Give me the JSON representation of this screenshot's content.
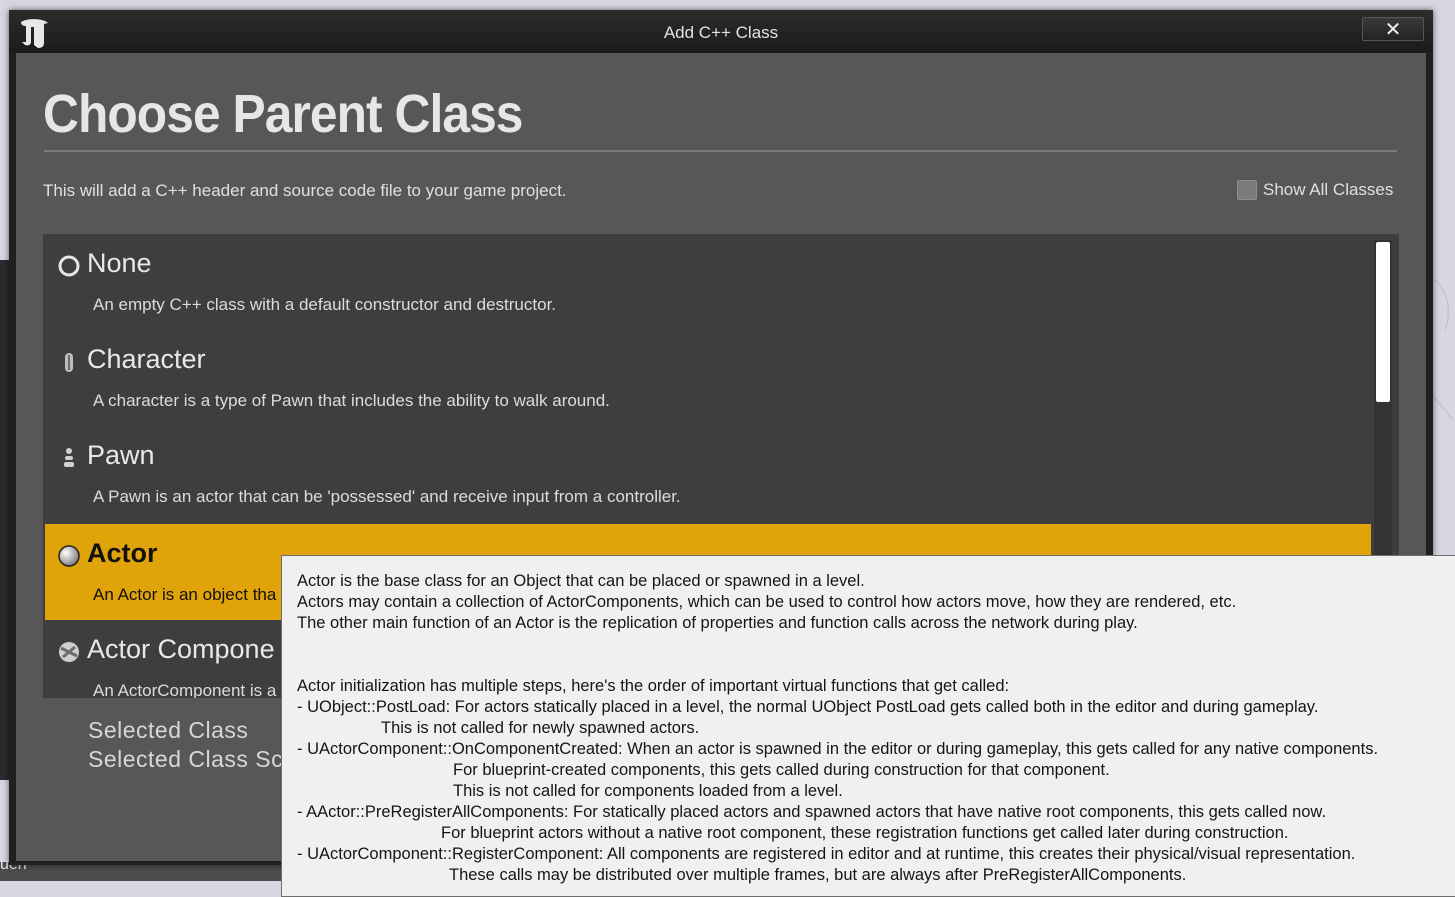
{
  "window": {
    "title": "Add C++ Class",
    "close_glyph": "✕"
  },
  "background": {
    "bottom_text": "uen"
  },
  "heading": "Choose Parent Class",
  "description": "This will add a C++ header and source code file to your game project.",
  "show_all_classes": {
    "label": "Show All Classes",
    "checked": false
  },
  "classes": [
    {
      "name": "None",
      "description": "An empty C++ class with a default constructor and destructor.",
      "icon": "none-radio-icon",
      "selected": false
    },
    {
      "name": "Character",
      "description": "A character is a type of Pawn that includes the ability to walk around.",
      "icon": "character-icon",
      "selected": false
    },
    {
      "name": "Pawn",
      "description": "A Pawn is an actor that can be 'possessed' and receive input from a controller.",
      "icon": "pawn-icon",
      "selected": false
    },
    {
      "name": "Actor",
      "description": "An Actor is an object tha",
      "icon": "actor-sphere-icon",
      "selected": true
    },
    {
      "name": "Actor Compone",
      "description": "An ActorComponent is a",
      "icon": "actor-component-icon",
      "selected": false
    }
  ],
  "selected_class": {
    "label": "Selected Class",
    "source_label": "Selected Class Sc"
  },
  "tooltip": {
    "lines": [
      "Actor is the base class for an Object that can be placed or spawned in a level.",
      "Actors may contain a collection of ActorComponents, which can be used to control how actors move, how they are rendered, etc.",
      "The other main function of an Actor is the replication of properties and function calls across the network during play.",
      "",
      "",
      "Actor initialization has multiple steps, here's the order of important virtual functions that get called:",
      "- UObject::PostLoad: For actors statically placed in a level, the normal UObject PostLoad gets called both in the editor and during gameplay.",
      "This is not called for newly spawned actors.",
      "- UActorComponent::OnComponentCreated: When an actor is spawned in the editor or during gameplay, this gets called for any native components.",
      "For blueprint-created components, this gets called during construction for that component.",
      "This is not called for components loaded from a level.",
      "- AActor::PreRegisterAllComponents: For statically placed actors and spawned actors that have native root components, this gets called now.",
      "For blueprint actors without a native root component, these registration functions get called later during construction.",
      "- UActorComponent::RegisterComponent: All components are registered in editor and at runtime, this creates their physical/visual representation.",
      "These calls may be distributed over multiple frames, but are always after PreRegisterAllComponents."
    ]
  },
  "colors": {
    "selected_highlight": "#e0a30a",
    "panel_bg": "#575757",
    "list_bg": "#3e3e3e",
    "tooltip_bg": "#f0f0f0"
  }
}
